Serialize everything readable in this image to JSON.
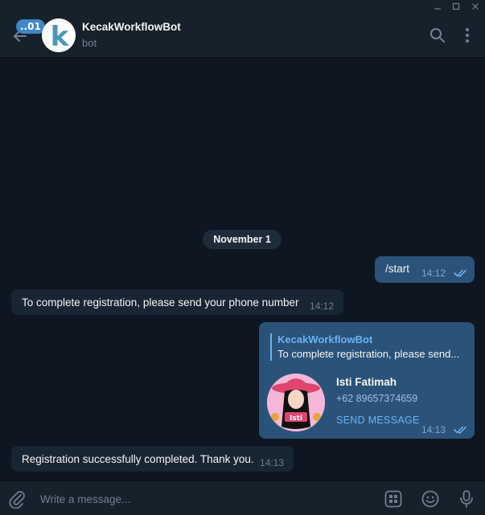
{
  "header": {
    "unread_count": "..01",
    "title": "KecakWorkflowBot",
    "status": "bot",
    "avatar_letter": "k"
  },
  "date_separator": "November 1",
  "messages": [
    {
      "direction": "out",
      "text": "/start",
      "time": "14:12",
      "read": true
    },
    {
      "direction": "in",
      "text": "To complete registration, please send your phone number",
      "time": "14:12"
    },
    {
      "direction": "out",
      "reply_to": {
        "name": "KecakWorkflowBot",
        "text": "To complete registration, please send..."
      },
      "contact": {
        "name": "Isti Fatimah",
        "phone": "+62 89657374659",
        "action": "SEND MESSAGE",
        "avatar_caption": "Isti"
      },
      "time": "14:13",
      "read": true
    },
    {
      "direction": "in",
      "text": "Registration successfully completed. Thank you.",
      "time": "14:13"
    }
  ],
  "composer": {
    "placeholder": "Write a message..."
  },
  "icons": {
    "back": "arrow-left-icon",
    "search": "search-icon",
    "more": "more-vertical-icon",
    "attach": "paperclip-icon",
    "commands": "bot-commands-icon",
    "emoji": "emoji-icon",
    "mic": "microphone-icon",
    "read": "double-check-icon"
  },
  "colors": {
    "background": "#0e1621",
    "panel": "#17212b",
    "outgoing_bubble": "#2b5278",
    "incoming_bubble": "#182533",
    "accent": "#6ab3f3",
    "badge": "#3f86c6"
  }
}
